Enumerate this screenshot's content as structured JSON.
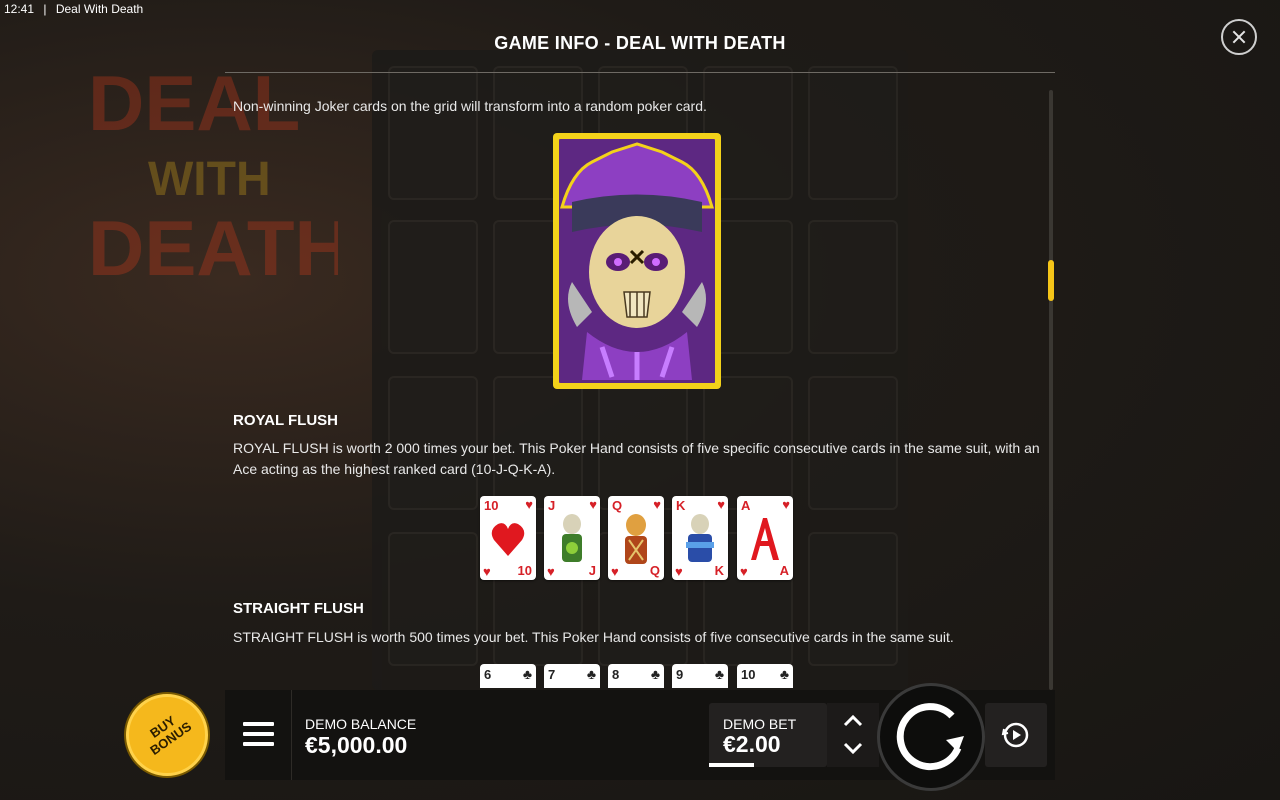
{
  "status": {
    "time": "12:41",
    "app_title": "Deal With Death"
  },
  "panel": {
    "title": "GAME INFO - DEAL WITH DEATH"
  },
  "joker_text": "Non-winning Joker cards on the grid will transform into a random poker card.",
  "royal_flush": {
    "heading": "ROYAL FLUSH",
    "text": "ROYAL FLUSH is worth 2 000 times your bet. This Poker Hand consists of five specific consecutive cards in the same suit, with an Ace acting as the highest ranked card (10-J-Q-K-A).",
    "cards": [
      "10",
      "J",
      "Q",
      "K",
      "A"
    ]
  },
  "straight_flush": {
    "heading": "STRAIGHT FLUSH",
    "text": "STRAIGHT FLUSH is worth 500 times your bet. This Poker Hand consists of five consecutive cards in the same suit.",
    "cards": [
      "6",
      "7",
      "8",
      "9",
      "10"
    ]
  },
  "bottom": {
    "buy_bonus": "BUY BONUS",
    "balance_label": "DEMO BALANCE",
    "balance_value": "€5,000.00",
    "bet_label": "DEMO BET",
    "bet_value": "€2.00"
  },
  "colors": {
    "accent": "#f5c518",
    "heart_red": "#d62027",
    "joker_purple": "#7b2fa8"
  },
  "icons": [
    "close-icon",
    "menu-icon",
    "chevron-up-icon",
    "chevron-down-icon",
    "spin-icon",
    "autoplay-icon"
  ]
}
